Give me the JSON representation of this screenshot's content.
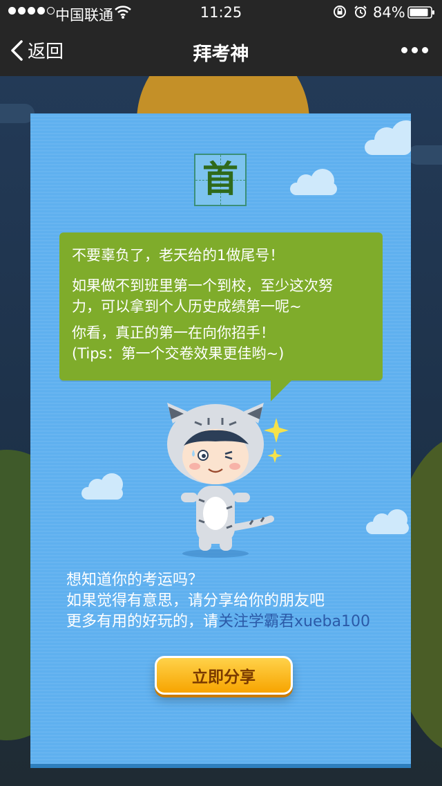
{
  "status_bar": {
    "carrier": "中国联通",
    "time": "11:25",
    "battery": "84%"
  },
  "nav": {
    "back_label": "返回",
    "title": "拜考神"
  },
  "card": {
    "character": "首",
    "bubble": {
      "line1": "不要辜负了，老天给的1做尾号！",
      "line2": "如果做不到班里第一个到校，至少这次努",
      "line3": "力，可以拿到个人历史成绩第一呢~",
      "line4": "你看，真正的第一在向你招手！",
      "line5": "(Tips：第一个交卷效果更佳哟~)"
    },
    "info": {
      "line1": "想知道你的考运吗？",
      "line2": "如果觉得有意思，请分享给你的朋友吧",
      "line3_prefix": "更多有用的好玩的，请",
      "line3_highlight": "关注学霸君xueba100"
    },
    "share_label": "立即分享"
  },
  "colors": {
    "card_bg": "#5fb0ef",
    "bubble_bg": "#7fac2b",
    "button": "#f7a400",
    "highlight_text": "#2b5aa8"
  }
}
